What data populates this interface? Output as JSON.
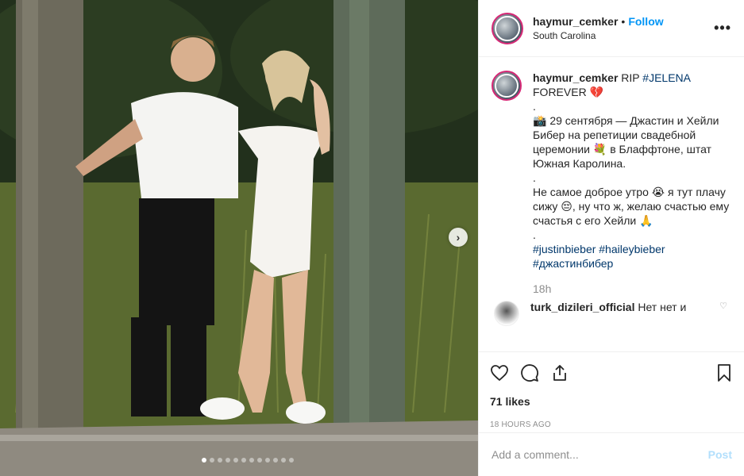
{
  "header": {
    "username": "haymur_cemker",
    "separator": "•",
    "follow_label": "Follow",
    "location": "South Carolina",
    "more_label": "•••"
  },
  "caption": {
    "username": "haymur_cemker",
    "title_text": "RIP ",
    "title_tag": "#JELENA",
    "title_line2": "FOREVER 💔",
    "dot1": ".",
    "body": "📸 29 сентября — Джастин и Хейли Бибер на репетиции свадебной церемонии 💐 в Блаффтоне, штат Южная Каролина.",
    "dot2": ".",
    "body2": "Не самое доброе утро 😭 я тут плачу сижу 😔, ну что ж, желаю счастью ему счастья с его Хейли 🙏",
    "dot3": ".",
    "tags_line1": "#justinbieber #haileybieber",
    "tags_line2": "#джастинбибер",
    "time": "18h"
  },
  "reply": {
    "username": "turk_dizileri_official",
    "text": "Нет нет и"
  },
  "actions": {
    "likes": "71 likes",
    "post_time": "18 HOURS AGO",
    "icons": [
      "heart-icon",
      "comment-icon",
      "share-icon",
      "bookmark-icon"
    ]
  },
  "add_comment": {
    "placeholder": "Add a comment...",
    "post_label": "Post"
  },
  "carousel": {
    "slide_count": 12,
    "active_index": 0
  },
  "colors": {
    "accent": "#0095f6",
    "post_disabled": "#b2dffc",
    "hashtag": "#00376b",
    "muted": "#8e8e8e"
  }
}
